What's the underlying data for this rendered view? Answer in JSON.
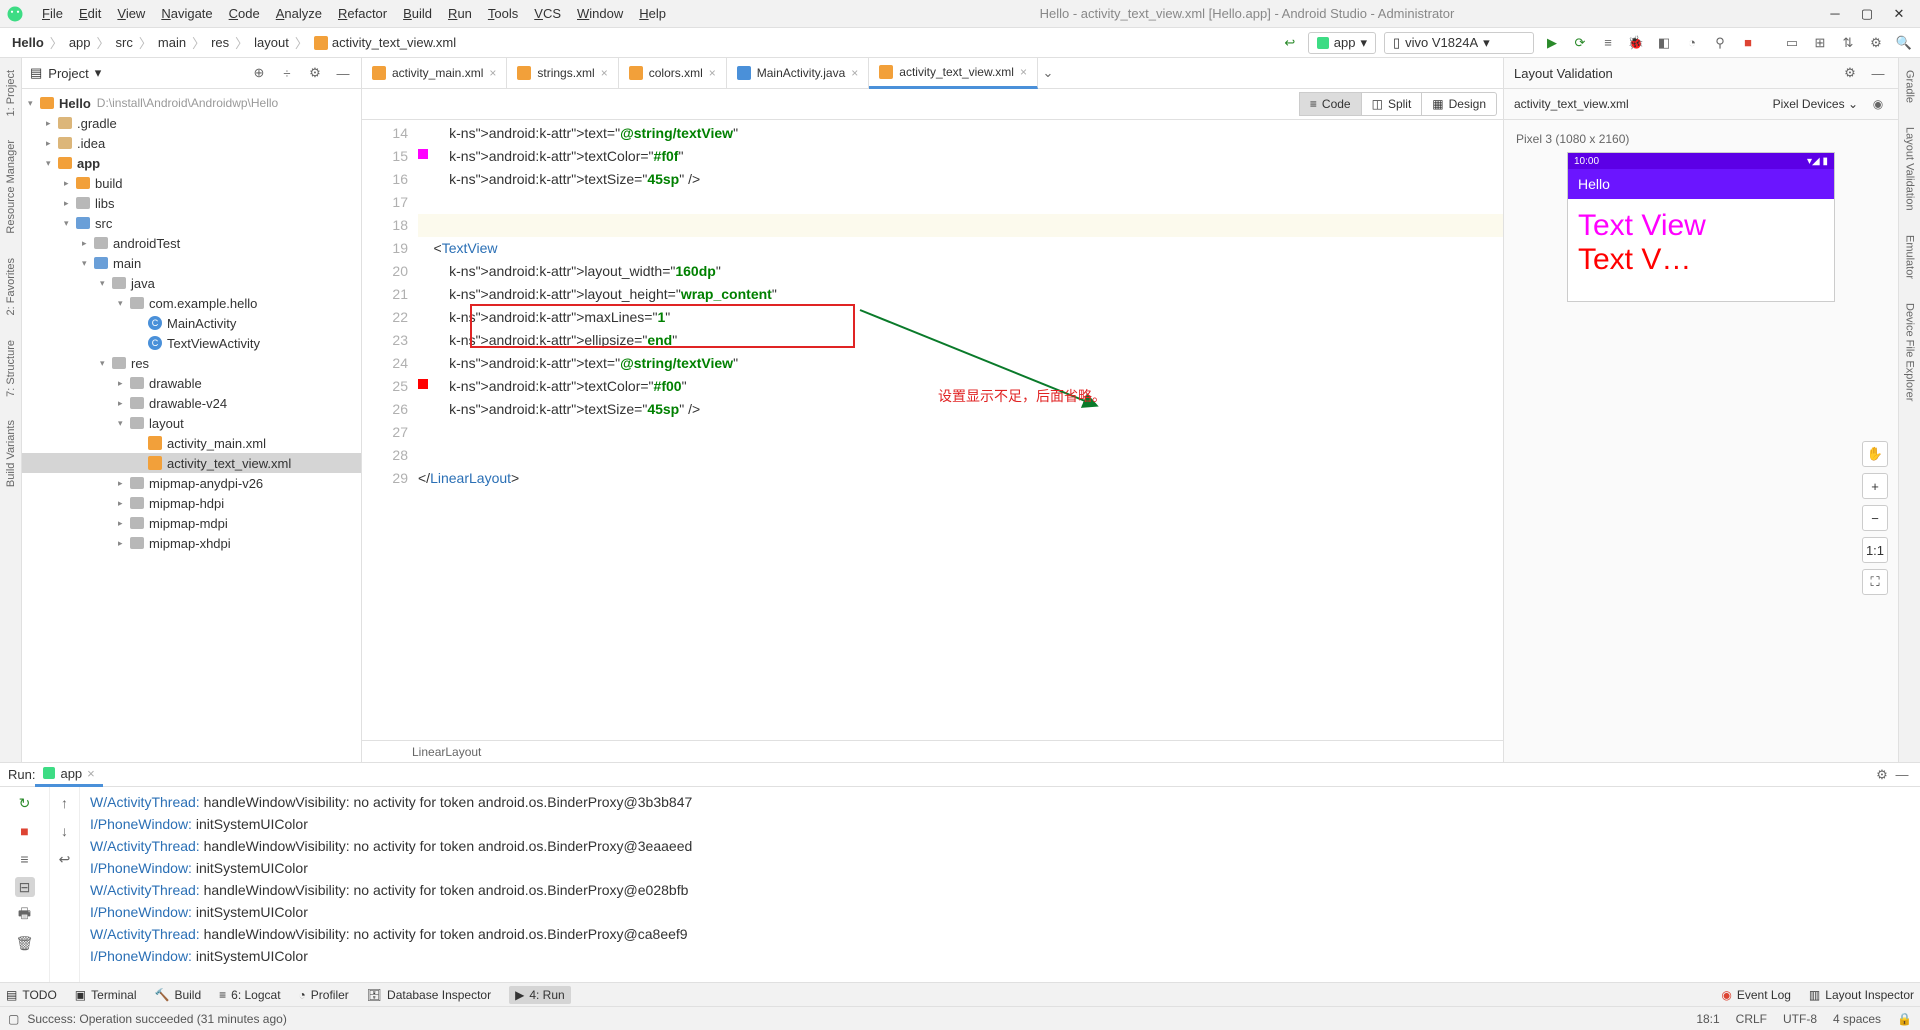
{
  "window": {
    "title": "Hello - activity_text_view.xml [Hello.app] - Android Studio - Administrator"
  },
  "menus": [
    "File",
    "Edit",
    "View",
    "Navigate",
    "Code",
    "Analyze",
    "Refactor",
    "Build",
    "Run",
    "Tools",
    "VCS",
    "Window",
    "Help"
  ],
  "breadcrumbs": [
    "Hello",
    "app",
    "src",
    "main",
    "res",
    "layout",
    "activity_text_view.xml"
  ],
  "runConfig": {
    "app": "app",
    "device": "vivo V1824A"
  },
  "projectPanel": {
    "title": "Project"
  },
  "tree": {
    "root": {
      "name": "Hello",
      "path": "D:\\install\\Android\\Androidwp\\Hello"
    },
    "items": [
      {
        "d": 1,
        "t": "folder",
        "name": ".gradle"
      },
      {
        "d": 1,
        "t": "folder",
        "name": ".idea"
      },
      {
        "d": 1,
        "t": "folder-o",
        "name": "app",
        "open": true
      },
      {
        "d": 2,
        "t": "folder-o",
        "name": "build"
      },
      {
        "d": 2,
        "t": "folder-g",
        "name": "libs"
      },
      {
        "d": 2,
        "t": "folder-b",
        "name": "src",
        "open": true
      },
      {
        "d": 3,
        "t": "folder-g",
        "name": "androidTest"
      },
      {
        "d": 3,
        "t": "folder-b",
        "name": "main",
        "open": true
      },
      {
        "d": 4,
        "t": "folder-g",
        "name": "java",
        "open": true
      },
      {
        "d": 5,
        "t": "folder-g",
        "name": "com.example.hello",
        "open": true
      },
      {
        "d": 6,
        "t": "class",
        "name": "MainActivity"
      },
      {
        "d": 6,
        "t": "class",
        "name": "TextViewActivity"
      },
      {
        "d": 4,
        "t": "folder-g",
        "name": "res",
        "open": true
      },
      {
        "d": 5,
        "t": "folder-g",
        "name": "drawable"
      },
      {
        "d": 5,
        "t": "folder-g",
        "name": "drawable-v24"
      },
      {
        "d": 5,
        "t": "folder-g",
        "name": "layout",
        "open": true
      },
      {
        "d": 6,
        "t": "xml",
        "name": "activity_main.xml"
      },
      {
        "d": 6,
        "t": "xml",
        "name": "activity_text_view.xml",
        "sel": true
      },
      {
        "d": 5,
        "t": "folder-g",
        "name": "mipmap-anydpi-v26"
      },
      {
        "d": 5,
        "t": "folder-g",
        "name": "mipmap-hdpi"
      },
      {
        "d": 5,
        "t": "folder-g",
        "name": "mipmap-mdpi"
      },
      {
        "d": 5,
        "t": "folder-g",
        "name": "mipmap-xhdpi"
      }
    ]
  },
  "tabs": [
    {
      "name": "activity_main.xml",
      "icon": "xml"
    },
    {
      "name": "strings.xml",
      "icon": "xml"
    },
    {
      "name": "colors.xml",
      "icon": "xml"
    },
    {
      "name": "MainActivity.java",
      "icon": "class"
    },
    {
      "name": "activity_text_view.xml",
      "icon": "xml",
      "active": true
    }
  ],
  "viewModes": {
    "code": "Code",
    "split": "Split",
    "design": "Design"
  },
  "code": {
    "startLine": 14,
    "lines": [
      "        android:text=\"@string/textView\"",
      "        android:textColor=\"#f0f\"",
      "        android:textSize=\"45sp\" />",
      "",
      "",
      "    <TextView",
      "        android:layout_width=\"160dp\"",
      "        android:layout_height=\"wrap_content\"",
      "        android:maxLines=\"1\"",
      "        android:ellipsize=\"end\"",
      "        android:text=\"@string/textView\"",
      "        android:textColor=\"#f00\"",
      "        android:textSize=\"45sp\" />",
      "",
      "",
      "</LinearLayout>"
    ],
    "annotation": "设置显示不足，后面省略。",
    "breadcrumb": "LinearLayout"
  },
  "preview": {
    "title": "Layout Validation",
    "toolbar": {
      "file": "activity_text_view.xml",
      "devices": "Pixel Devices"
    },
    "deviceLabel": "Pixel 3 (1080 x 2160)",
    "statusTime": "10:00",
    "appTitle": "Hello",
    "text1": "Text View",
    "text2": "Text V…"
  },
  "runPanel": {
    "label": "Run:",
    "tab": "app",
    "logs": [
      "W/ActivityThread: handleWindowVisibility: no activity for token android.os.BinderProxy@3b3b847",
      "I/PhoneWindow: initSystemUIColor",
      "W/ActivityThread: handleWindowVisibility: no activity for token android.os.BinderProxy@3eaaeed",
      "I/PhoneWindow: initSystemUIColor",
      "W/ActivityThread: handleWindowVisibility: no activity for token android.os.BinderProxy@e028bfb",
      "I/PhoneWindow: initSystemUIColor",
      "W/ActivityThread: handleWindowVisibility: no activity for token android.os.BinderProxy@ca8eef9",
      "I/PhoneWindow: initSystemUIColor"
    ]
  },
  "bottomTabs": {
    "todo": "TODO",
    "terminal": "Terminal",
    "build": "Build",
    "logcat": "6: Logcat",
    "profiler": "Profiler",
    "dbi": "Database Inspector",
    "run": "4: Run",
    "eventlog": "Event Log",
    "layoutinsp": "Layout Inspector"
  },
  "status": {
    "message": "Success: Operation succeeded (31 minutes ago)",
    "pos": "18:1",
    "eol": "CRLF",
    "enc": "UTF-8",
    "indent": "4 spaces"
  },
  "sidebars": {
    "left": [
      "1: Project",
      "Resource Manager",
      "2: Favorites",
      "7: Structure",
      "Build Variants"
    ],
    "right": [
      "Gradle",
      "Layout Validation",
      "Emulator",
      "Device File Explorer"
    ]
  }
}
